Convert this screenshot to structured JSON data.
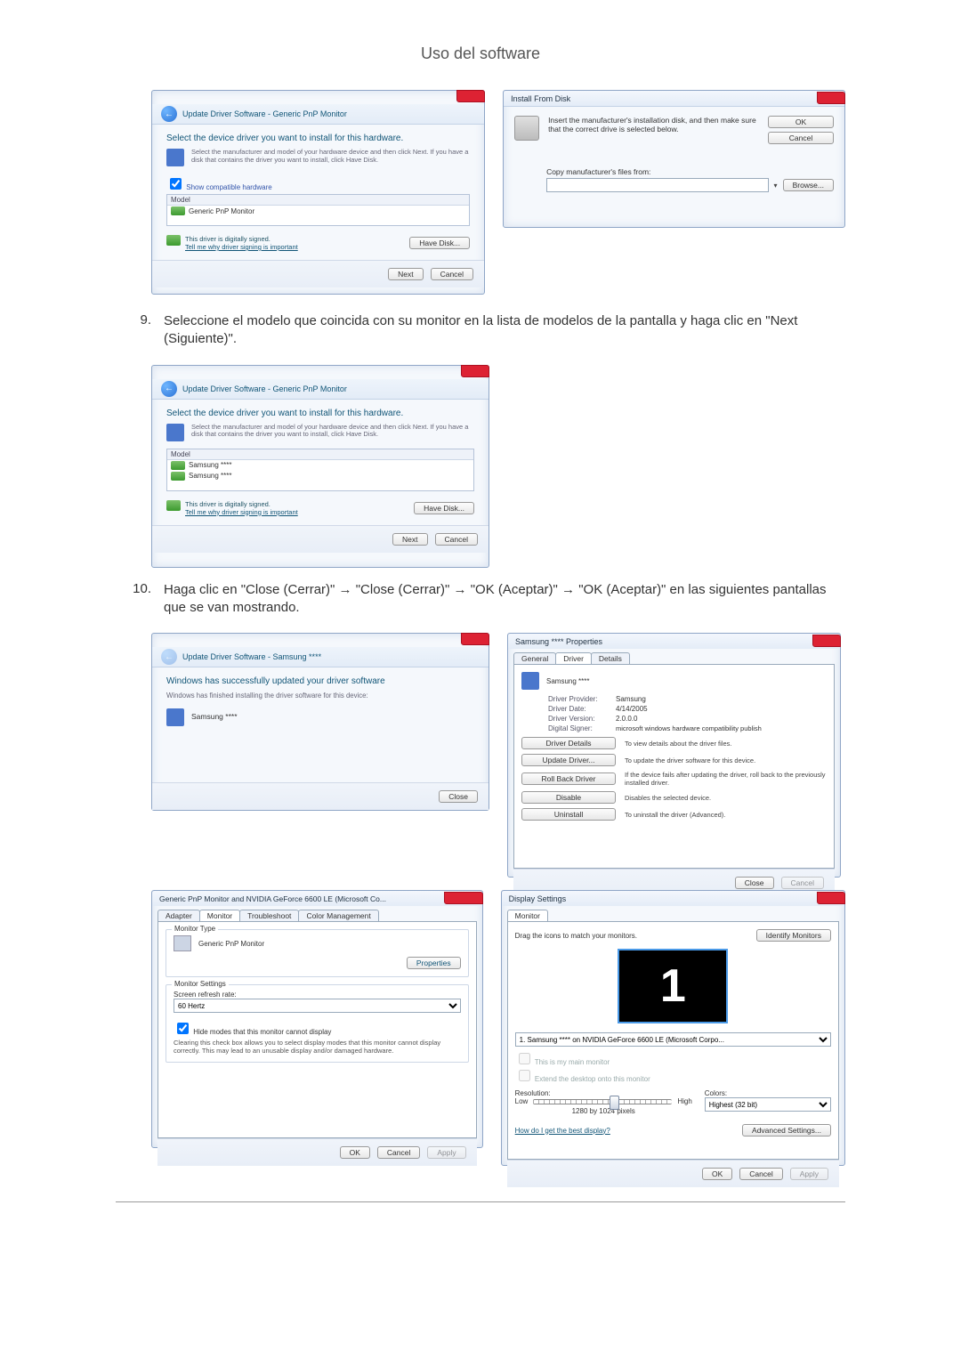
{
  "page_title": "Uso del software",
  "steps": {
    "s9": {
      "num": "9.",
      "text": "Seleccione el modelo que coincida con su monitor en la lista de modelos de la pantalla y haga clic en \"Next (Siguiente)\"."
    },
    "s10": {
      "num": "10.",
      "text": "Haga clic en \"Close (Cerrar)\" → \"Close (Cerrar)\" → \"OK (Aceptar)\" → \"OK (Aceptar)\" en las siguientes pantallas que se van mostrando."
    }
  },
  "wiz1": {
    "crumb": "Update Driver Software - Generic PnP Monitor",
    "heading": "Select the device driver you want to install for this hardware.",
    "sub": "Select the manufacturer and model of your hardware device and then click Next. If you have a disk that contains the driver you want to install, click Have Disk.",
    "show_compat": "Show compatible hardware",
    "col_model": "Model",
    "item": "Generic PnP Monitor",
    "signed": "This driver is digitally signed.",
    "signed_link": "Tell me why driver signing is important",
    "have_disk": "Have Disk...",
    "next": "Next",
    "cancel": "Cancel"
  },
  "install_disk": {
    "title": "Install From Disk",
    "msg": "Insert the manufacturer's installation disk, and then make sure that the correct drive is selected below.",
    "ok": "OK",
    "cancel": "Cancel",
    "copy_from": "Copy manufacturer's files from:",
    "browse": "Browse..."
  },
  "wiz2": {
    "crumb": "Update Driver Software - Generic PnP Monitor",
    "heading": "Select the device driver you want to install for this hardware.",
    "sub": "Select the manufacturer and model of your hardware device and then click Next. If you have a disk that contains the driver you want to install, click Have Disk.",
    "col_model": "Model",
    "item1": "Samsung ****",
    "item2": "Samsung ****",
    "signed": "This driver is digitally signed.",
    "signed_link": "Tell me why driver signing is important",
    "have_disk": "Have Disk...",
    "next": "Next",
    "cancel": "Cancel"
  },
  "finish": {
    "crumb": "Update Driver Software - Samsung ****",
    "heading": "Windows has successfully updated your driver software",
    "sub": "Windows has finished installing the driver software for this device:",
    "device": "Samsung ****",
    "close": "Close"
  },
  "driver": {
    "title": "Samsung **** Properties",
    "tab_general": "General",
    "tab_driver": "Driver",
    "tab_details": "Details",
    "device": "Samsung ****",
    "k_provider": "Driver Provider:",
    "v_provider": "Samsung",
    "k_date": "Driver Date:",
    "v_date": "4/14/2005",
    "k_ver": "Driver Version:",
    "v_ver": "2.0.0.0",
    "k_signer": "Digital Signer:",
    "v_signer": "microsoft windows hardware compatibility publish",
    "b_details": "Driver Details",
    "d_details": "To view details about the driver files.",
    "b_update": "Update Driver...",
    "d_update": "To update the driver software for this device.",
    "b_rollback": "Roll Back Driver",
    "d_rollback": "If the device fails after updating the driver, roll back to the previously installed driver.",
    "b_disable": "Disable",
    "d_disable": "Disables the selected device.",
    "b_uninstall": "Uninstall",
    "d_uninstall": "To uninstall the driver (Advanced).",
    "close": "Close",
    "cancel": "Cancel"
  },
  "advprops": {
    "title": "Generic PnP Monitor and NVIDIA GeForce 6600 LE (Microsoft Co...",
    "tab_adapter": "Adapter",
    "tab_monitor": "Monitor",
    "tab_trouble": "Troubleshoot",
    "tab_color": "Color Management",
    "g_type": "Monitor Type",
    "type_name": "Generic PnP Monitor",
    "properties": "Properties",
    "g_settings": "Monitor Settings",
    "refresh_label": "Screen refresh rate:",
    "refresh_val": "60 Hertz",
    "hide_modes": "Hide modes that this monitor cannot display",
    "hide_desc": "Clearing this check box allows you to select display modes that this monitor cannot display correctly. This may lead to an unusable display and/or damaged hardware.",
    "ok": "OK",
    "cancel": "Cancel",
    "apply": "Apply"
  },
  "dispset": {
    "title": "Display Settings",
    "tab_monitor": "Monitor",
    "drag": "Drag the icons to match your monitors.",
    "identify": "Identify Monitors",
    "mon_label": "1",
    "combo": "1. Samsung **** on NVIDIA GeForce 6600 LE (Microsoft Corpo...",
    "main": "This is my main monitor",
    "extend": "Extend the desktop onto this monitor",
    "res_label": "Resolution:",
    "low": "Low",
    "high": "High",
    "res_val": "1280 by 1024 pixels",
    "colors_label": "Colors:",
    "colors_val": "Highest (32 bit)",
    "best_link": "How do I get the best display?",
    "advanced": "Advanced Settings...",
    "ok": "OK",
    "cancel": "Cancel",
    "apply": "Apply"
  }
}
